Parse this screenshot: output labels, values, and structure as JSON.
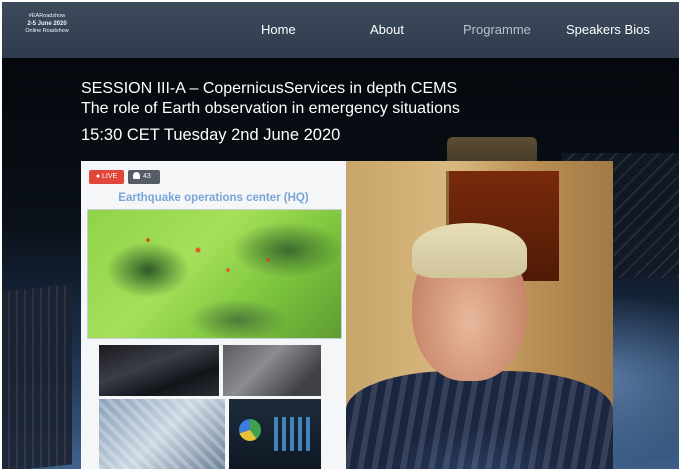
{
  "brand": {
    "tag": "#EARoadshow",
    "dates": "2-5 June 2020",
    "subtitle": "Online Roadshow"
  },
  "nav": {
    "items": [
      {
        "label": "Home",
        "active": false
      },
      {
        "label": "About",
        "active": false
      },
      {
        "label": "Programme",
        "active": true
      },
      {
        "label": "Speakers Bios",
        "active": false
      }
    ]
  },
  "session": {
    "title": "SESSION III-A – CopernicusServices in depth CEMS",
    "subtitle": "The role of Earth observation in emergency situations",
    "time": "15:30 CET Tuesday 2nd June 2020"
  },
  "video": {
    "live_label": "● LIVE",
    "viewer_count": "43",
    "slide_heading": "Earthquake operations center (HQ)"
  },
  "colors": {
    "nav_bg": "#3c4a5c",
    "live_badge": "#e0473a",
    "slide_heading": "#7aa6d6",
    "active_nav": "#b7c0cb"
  }
}
